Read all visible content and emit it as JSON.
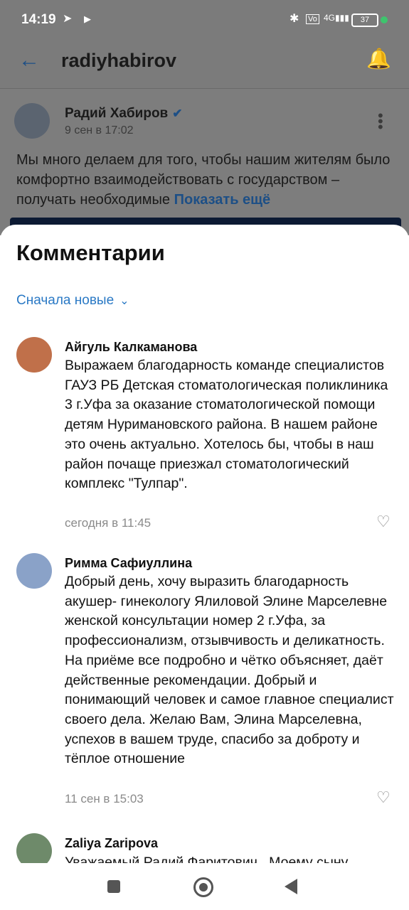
{
  "status_bar": {
    "time": "14:19",
    "battery": "37"
  },
  "app_bar": {
    "account": "radiyhabirov"
  },
  "post": {
    "author": "Радий Хабиров",
    "date": "9 сен в 17:02",
    "text": "Мы много делаем для того, чтобы нашим жителям было комфортно взаимодействовать с государством – получать необходимые",
    "show_more": "Показать ещё"
  },
  "comments_sheet": {
    "title": "Комментарии",
    "sort_label": "Сначала новые",
    "comments": [
      {
        "author": "Айгуль Калкаманова",
        "text": "Выражаем благодарность команде специалистов ГАУЗ РБ Детская стоматологическая поликлиника 3 г.Уфа за оказание стоматологической помощи детям Нуримановского района. В нашем районе это очень актуально. Хотелось бы, чтобы в наш район почаще приезжал стоматологический комплекс \"Тулпар\".",
        "time": "сегодня в 11:45"
      },
      {
        "author": "Римма Сафиуллина",
        "text": "Добрый день, хочу выразить благодарность акушер- гинекологу Ялиловой Элине Марселевне женской консультации номер 2 г.Уфа, за профессионализм, отзывчивость и деликатность. На приёме все подробно и чётко объясняет, даёт действенные рекомендации. Добрый и понимающий человек и самое главное специалист своего дела. Желаю Вам, Элина Марселевна, успехов в вашем труде, спасибо за доброту и тёплое отношение",
        "time": "11 сен в 15:03"
      },
      {
        "author": "Zaliya Zaripova",
        "text": "Уважаемый Радий Фаритович , Моему сыну"
      }
    ]
  },
  "icons": {
    "back": "arrow-left-icon",
    "notifications": "bell-plus-icon",
    "verified": "check-icon",
    "like": "heart-icon"
  }
}
